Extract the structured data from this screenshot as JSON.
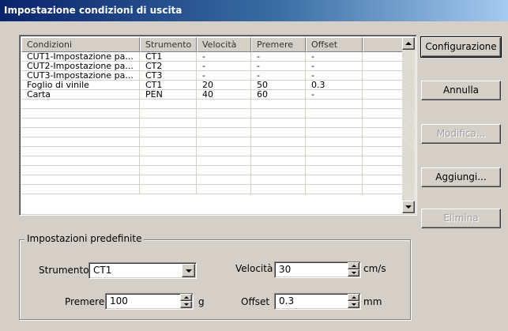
{
  "window": {
    "title": "Impostazione condizioni di uscita"
  },
  "table": {
    "columns": [
      "Condizioni",
      "Strumento",
      "Velocità",
      "Premere",
      "Offset",
      ""
    ],
    "rows": [
      [
        "CUT1-Impostazione pa...",
        "CT1",
        "-",
        "-",
        "-",
        ""
      ],
      [
        "CUT2-Impostazione pa...",
        "CT2",
        "-",
        "-",
        "-",
        ""
      ],
      [
        "CUT3-Impostazione pa...",
        "CT3",
        "-",
        "-",
        "-",
        ""
      ],
      [
        "Foglio di vinile",
        "CT1",
        "20",
        "50",
        "0.3",
        ""
      ],
      [
        "Carta",
        "PEN",
        "40",
        "60",
        "-",
        ""
      ]
    ],
    "empty_rows": 10
  },
  "buttons": {
    "configurazione": "Configurazione",
    "annulla": "Annulla",
    "modifica": "Modifica...",
    "aggiungi": "Aggiungi...",
    "elimina": "Elimina"
  },
  "defaults": {
    "group_label": "Impostazioni predefinite",
    "strumento_label": "Strumento",
    "strumento_value": "CT1",
    "velocita_label": "Velocità",
    "velocita_value": "30",
    "velocita_unit": "cm/s",
    "premere_label": "Premere",
    "premere_value": "100",
    "premere_unit": "g",
    "offset_label": "Offset",
    "offset_value": "0.3",
    "offset_unit": "mm"
  },
  "icons": {
    "scroll_up": "arrow-up-icon",
    "scroll_down": "arrow-down-icon",
    "combo": "chevron-down-icon",
    "spin": "spinner-icon"
  }
}
